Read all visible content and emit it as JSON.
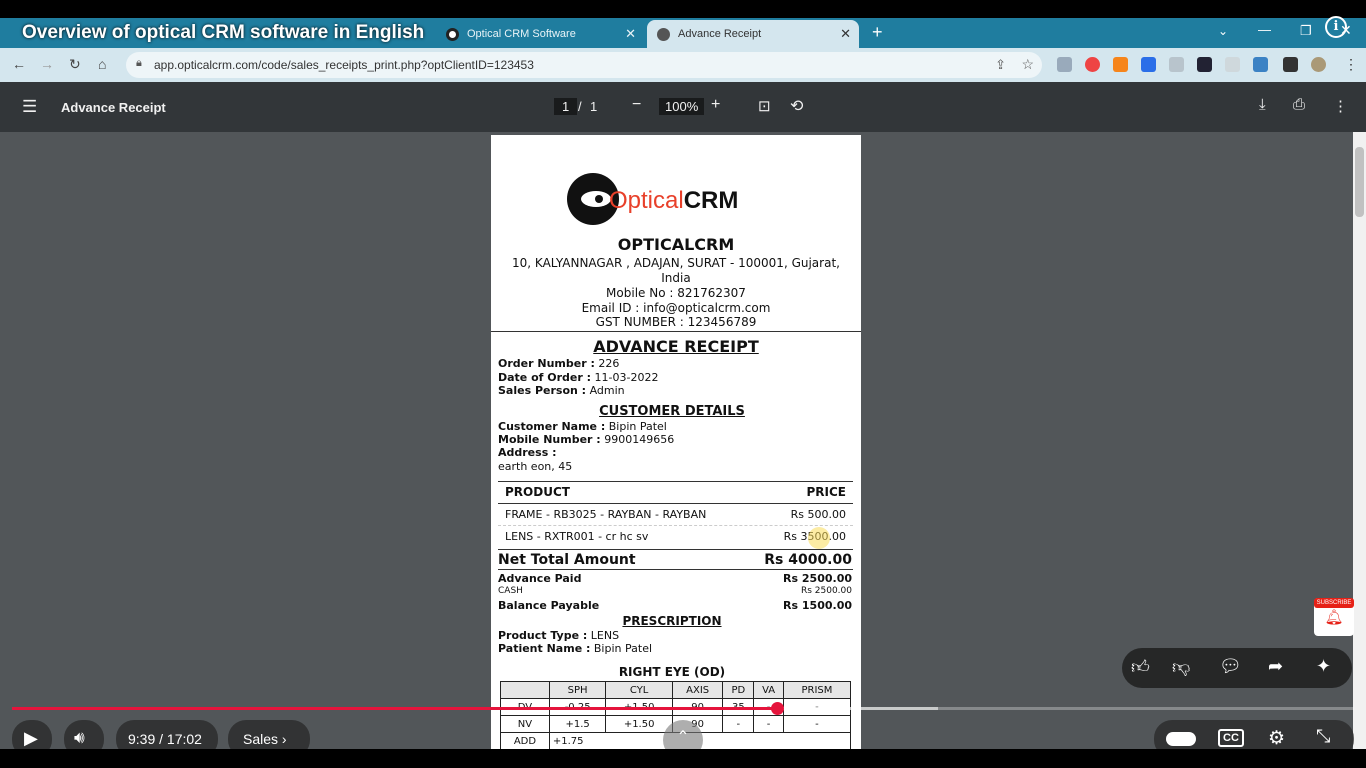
{
  "video": {
    "title": "Overview of optical CRM software in English",
    "time": "9:39 / 17:02",
    "chapter": "Sales"
  },
  "browser": {
    "tabs": [
      {
        "label": "Optical CRM Software"
      },
      {
        "label": "Advance Receipt"
      }
    ],
    "url": "app.opticalcrm.com/code/sales_receipts_print.php?optClientID=123453",
    "new_tab": "+"
  },
  "pdf": {
    "title": "Advance Receipt",
    "page_current": "1",
    "page_sep": "/",
    "page_total": "1",
    "zoom": "100%"
  },
  "receipt": {
    "logo_a": "Optical",
    "logo_b": "CRM",
    "company": "OPTICALCRM",
    "addr1": "10, KALYANNAGAR , ADAJAN, SURAT - 100001, Gujarat,",
    "addr2": "India",
    "mobile": "Mobile No : 821762307",
    "email": "Email ID : info@opticalcrm.com",
    "gst": "GST NUMBER : 123456789",
    "heading": "ADVANCE RECEIPT",
    "order_label": "Order Number :",
    "order_value": "226",
    "date_label": "Date of Order :",
    "date_value": "11-03-2022",
    "sales_label": "Sales Person :",
    "sales_value": "Admin",
    "cust_heading": "CUSTOMER DETAILS",
    "cname_label": "Customer Name :",
    "cname_value": "Bipin Patel",
    "cmobile_label": "Mobile Number :",
    "cmobile_value": "9900149656",
    "caddr_label": "Address :",
    "caddr_value": "earth eon, 45",
    "col_product": "PRODUCT",
    "col_price": "PRICE",
    "items": [
      {
        "name": "FRAME - RB3025 - RAYBAN - RAYBAN",
        "price": "Rs 500.00"
      },
      {
        "name": "LENS - RXTR001 - cr hc sv",
        "price": "Rs 3500.00"
      }
    ],
    "net_label": "Net Total Amount",
    "net_value": "Rs 4000.00",
    "adv_label": "Advance Paid",
    "adv_value": "Rs 2500.00",
    "cash_label": "CASH",
    "cash_value": "Rs 2500.00",
    "bal_label": "Balance Payable",
    "bal_value": "Rs 1500.00",
    "rx_heading": "PRESCRIPTION",
    "ptype_label": "Product Type :",
    "ptype_value": "LENS",
    "pname_label": "Patient Name :",
    "pname_value": "Bipin Patel",
    "eye_heading": "RIGHT EYE (OD)",
    "rx_cols": [
      "",
      "SPH",
      "CYL",
      "AXIS",
      "PD",
      "VA",
      "PRISM"
    ],
    "rx_dv": [
      "DV",
      "-0.25",
      "+1.50",
      "90",
      "35",
      "-",
      "-"
    ],
    "rx_nv": [
      "NV",
      "+1.5",
      "+1.50",
      "90",
      "-",
      "-",
      "-"
    ],
    "rx_add": [
      "ADD",
      "+1.75"
    ]
  },
  "subscribe": "SUBSCRIBE",
  "progress": {
    "played": 0.57,
    "buffered": 0.69
  },
  "colors": {
    "tabstrip": "#1f7d9f",
    "pdfbar": "#323639",
    "viewer": "#525659",
    "progress": "#e5143c"
  }
}
